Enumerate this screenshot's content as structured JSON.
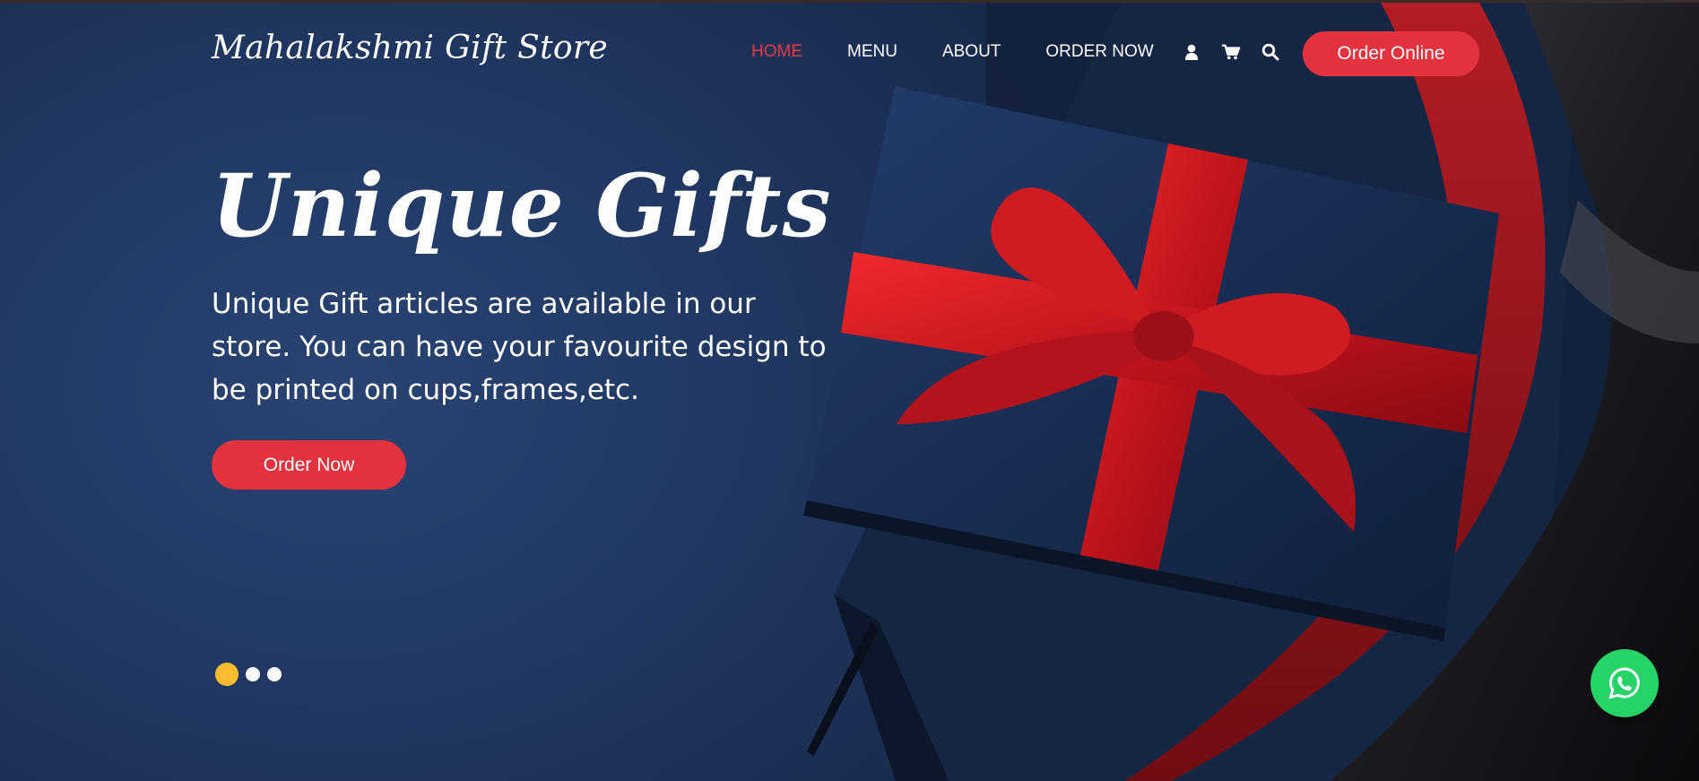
{
  "brand": {
    "name": "Mahalakshmi Gift Store"
  },
  "nav": {
    "items": [
      {
        "label": "HOME",
        "active": true
      },
      {
        "label": "MENU",
        "active": false
      },
      {
        "label": "ABOUT",
        "active": false
      },
      {
        "label": "ORDER NOW",
        "active": false
      }
    ],
    "icons": [
      "user-icon",
      "cart-icon",
      "search-icon"
    ],
    "cta_label": "Order Online"
  },
  "hero": {
    "title": "Unique Gifts",
    "text": "Unique Gift articles are available in our store. You can have your favourite design to be printed on cups,frames,etc.",
    "button_label": "Order Now"
  },
  "slider": {
    "slide_count": 3,
    "active_index": 0
  },
  "floating": {
    "icon": "whatsapp-icon"
  },
  "colors": {
    "accent": "#e5323f",
    "active_nav": "#e63946",
    "background": "#213964",
    "dot_active": "#fbbd2f",
    "whatsapp": "#25d366"
  }
}
